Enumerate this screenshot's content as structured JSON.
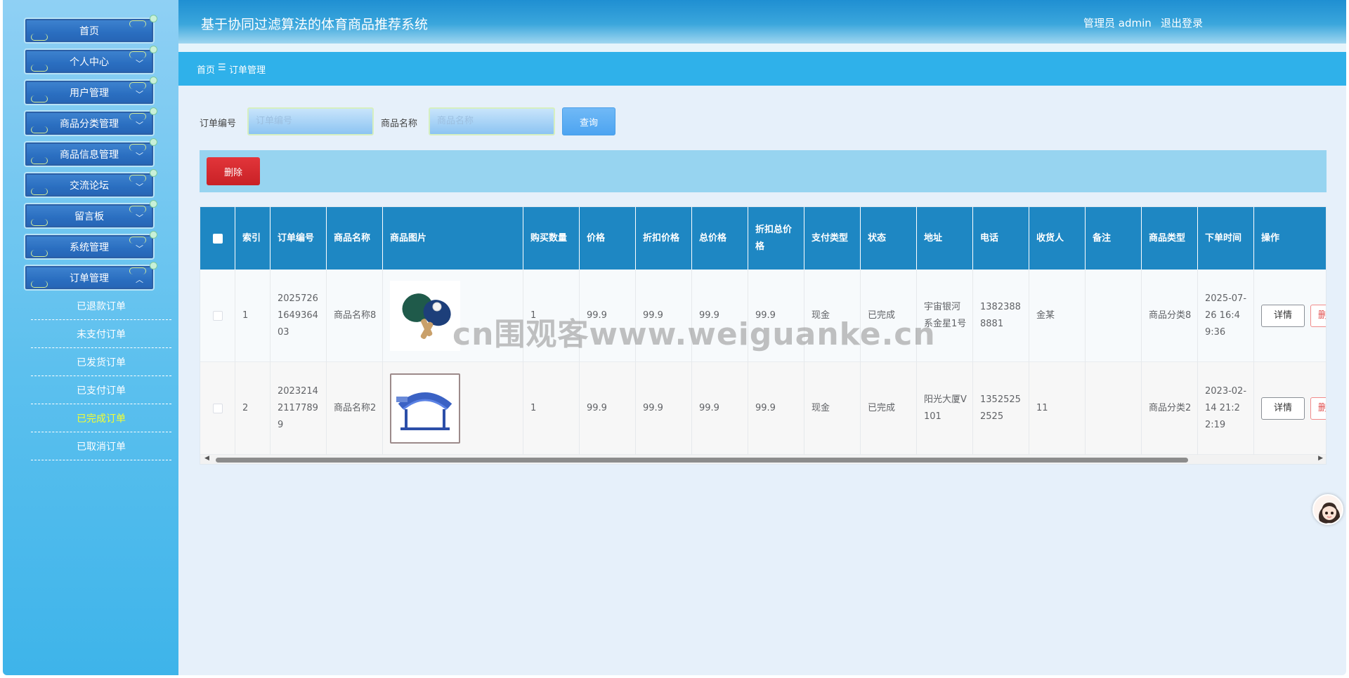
{
  "app": {
    "title": "基于协同过滤算法的体育商品推荐系统",
    "user_label": "管理员 admin",
    "logout_label": "退出登录"
  },
  "sidebar": {
    "menu": [
      {
        "label": "首页",
        "chevron": false
      },
      {
        "label": "个人中心",
        "chevron": true
      },
      {
        "label": "用户管理",
        "chevron": true
      },
      {
        "label": "商品分类管理",
        "chevron": true
      },
      {
        "label": "商品信息管理",
        "chevron": true
      },
      {
        "label": "交流论坛",
        "chevron": true
      },
      {
        "label": "留言板",
        "chevron": true
      },
      {
        "label": "系统管理",
        "chevron": true
      },
      {
        "label": "订单管理",
        "chevron": true
      }
    ],
    "submenu": [
      {
        "label": "已退款订单",
        "active": false
      },
      {
        "label": "未支付订单",
        "active": false
      },
      {
        "label": "已发货订单",
        "active": false
      },
      {
        "label": "已支付订单",
        "active": false
      },
      {
        "label": "已完成订单",
        "active": true
      },
      {
        "label": "已取消订单",
        "active": false
      }
    ],
    "active_submenu_color": "#f5ff2e"
  },
  "breadcrumb": {
    "home": "首页",
    "separator": "☰",
    "current": "订单管理"
  },
  "search": {
    "order_no_label": "订单编号",
    "order_no_placeholder": "订单编号",
    "product_name_label": "商品名称",
    "product_name_placeholder": "商品名称",
    "query_label": "查询"
  },
  "actions": {
    "delete_label": "删除"
  },
  "table": {
    "columns": [
      "索引",
      "订单编号",
      "商品名称",
      "商品图片",
      "购买数量",
      "价格",
      "折扣价格",
      "总价格",
      "折扣总价格",
      "支付类型",
      "状态",
      "地址",
      "电话",
      "收货人",
      "备注",
      "商品类型",
      "下单时间",
      "操作"
    ],
    "rows": [
      {
        "index": "1",
        "order_no": "20257261649364 03",
        "product_name": "商品名称8",
        "image": "ping-pong-paddles",
        "quantity": "1",
        "price": "99.9",
        "discount_price": "99.9",
        "total": "99.9",
        "discount_total": "99.9",
        "pay_type": "现金",
        "status": "已完成",
        "address": "宇宙银河系金星1号",
        "phone": "13823888881",
        "receiver": "金某",
        "note": "",
        "category": "商品分类8",
        "time": "2025-07-26 16:49:36",
        "detail_label": "详情",
        "delete_label": "删除"
      },
      {
        "index": "2",
        "order_no": "20232142117789 9",
        "product_name": "商品名称2",
        "image": "sit-up-bench",
        "quantity": "1",
        "price": "99.9",
        "discount_price": "99.9",
        "total": "99.9",
        "discount_total": "99.9",
        "pay_type": "现金",
        "status": "已完成",
        "address": "阳光大厦V101",
        "phone": "13525252525",
        "receiver": "11",
        "note": "",
        "category": "商品分类2",
        "time": "2023-02-14 21:22:19",
        "detail_label": "详情",
        "delete_label": "删除"
      }
    ]
  },
  "watermark": "cn围观客www.weiguanke.cn",
  "colors": {
    "header": "#1f8fd2",
    "breadcrumb_bar": "#2fb1ea",
    "table_header": "#1e87c3",
    "delete_button": "#d6292e",
    "query_button": "#4da4f1"
  }
}
